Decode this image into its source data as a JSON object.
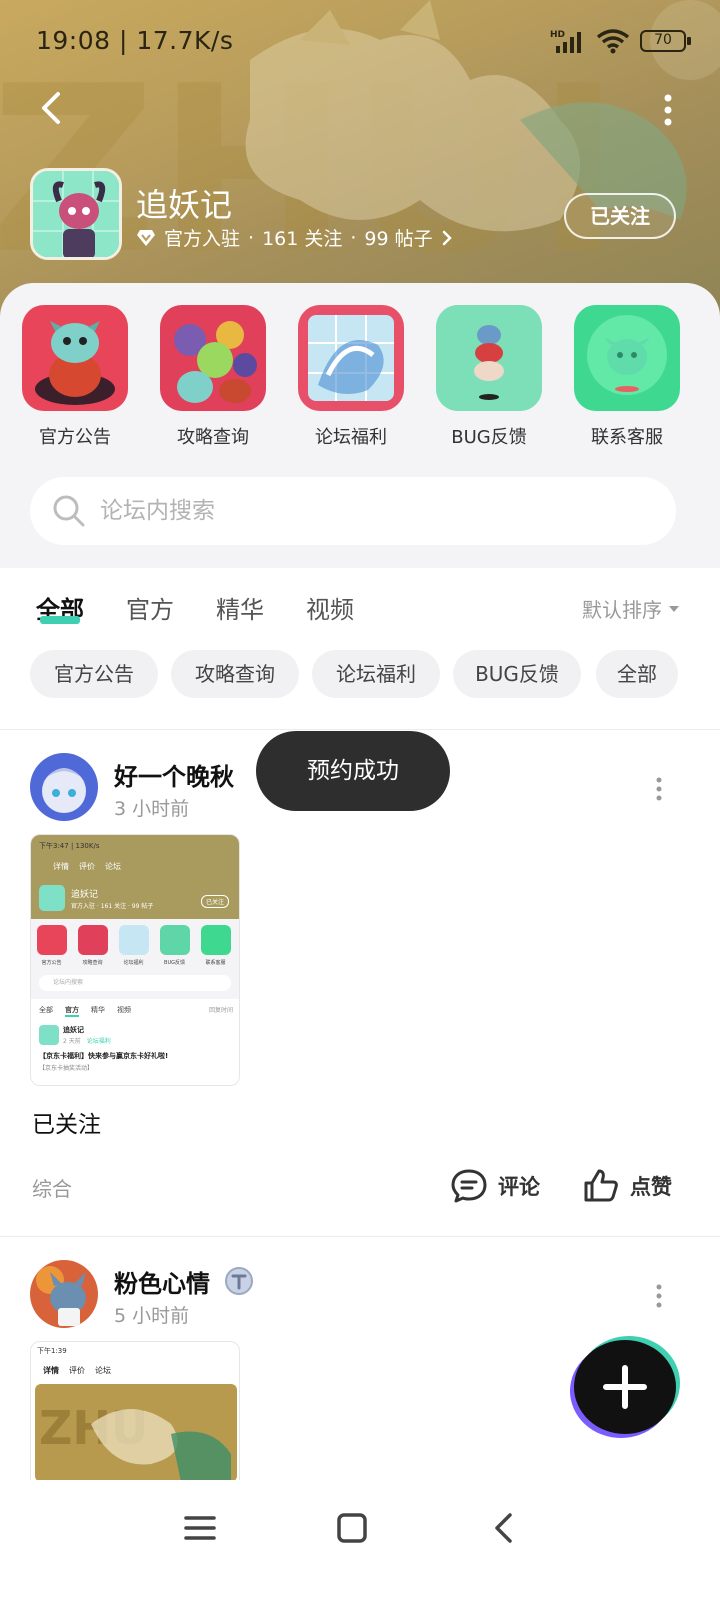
{
  "status_bar": {
    "time": "19:08 | 17.7K/s",
    "battery": "70",
    "network": "HD"
  },
  "forum": {
    "name": "追妖记",
    "official_badge": "官方入驻",
    "followers": "161 关注",
    "posts": "99 帖子",
    "separator": "·",
    "follow_label": "已关注"
  },
  "quick_links": [
    {
      "label": "官方公告"
    },
    {
      "label": "攻略查询"
    },
    {
      "label": "论坛福利"
    },
    {
      "label": "BUG反馈"
    },
    {
      "label": "联系客服"
    }
  ],
  "search": {
    "placeholder": "论坛内搜索"
  },
  "tabs": [
    {
      "label": "全部"
    },
    {
      "label": "官方"
    },
    {
      "label": "精华"
    },
    {
      "label": "视频"
    }
  ],
  "sort": {
    "label": "默认排序"
  },
  "chips": [
    {
      "label": "官方公告"
    },
    {
      "label": "攻略查询"
    },
    {
      "label": "论坛福利"
    },
    {
      "label": "BUG反馈"
    },
    {
      "label": "全部"
    }
  ],
  "posts": [
    {
      "author": "好一个晚秋",
      "time": "3 小时前",
      "text": "已关注",
      "category": "综合",
      "comment_label": "评论",
      "like_label": "点赞",
      "thumb": {
        "status": "下午3:47 | 130K/s",
        "tabs": [
          "详情",
          "评价",
          "论坛"
        ],
        "forum_name": "追妖记",
        "forum_meta": "官方入驻 · 161 关注 · 99 帖子",
        "follow": "已关注",
        "icons": [
          "官方公告",
          "攻略查询",
          "论坛福利",
          "BUG反馈",
          "联系客服"
        ],
        "search": "论坛内搜索",
        "filter": [
          "全部",
          "官方",
          "精华",
          "视频"
        ],
        "sort": "回复时间",
        "post_author": "追妖记",
        "post_time": "2 天前",
        "post_tag": "论坛福利",
        "post_title": "【京东卡福利】快来参与赢京东卡好礼啦!",
        "post_sub": "【京东卡抽奖活动】"
      }
    },
    {
      "author": "粉色心情",
      "time": "5 小时前",
      "thumb": {
        "status": "下午1:39",
        "tabs": [
          "详情",
          "评价",
          "论坛"
        ]
      }
    }
  ],
  "toast": {
    "text": "预约成功"
  },
  "colors": {
    "accent": "#3ed0b0",
    "banner": "#b79c5c",
    "panel": "#f4f4f6",
    "toast_bg": "#2e2e2e"
  }
}
